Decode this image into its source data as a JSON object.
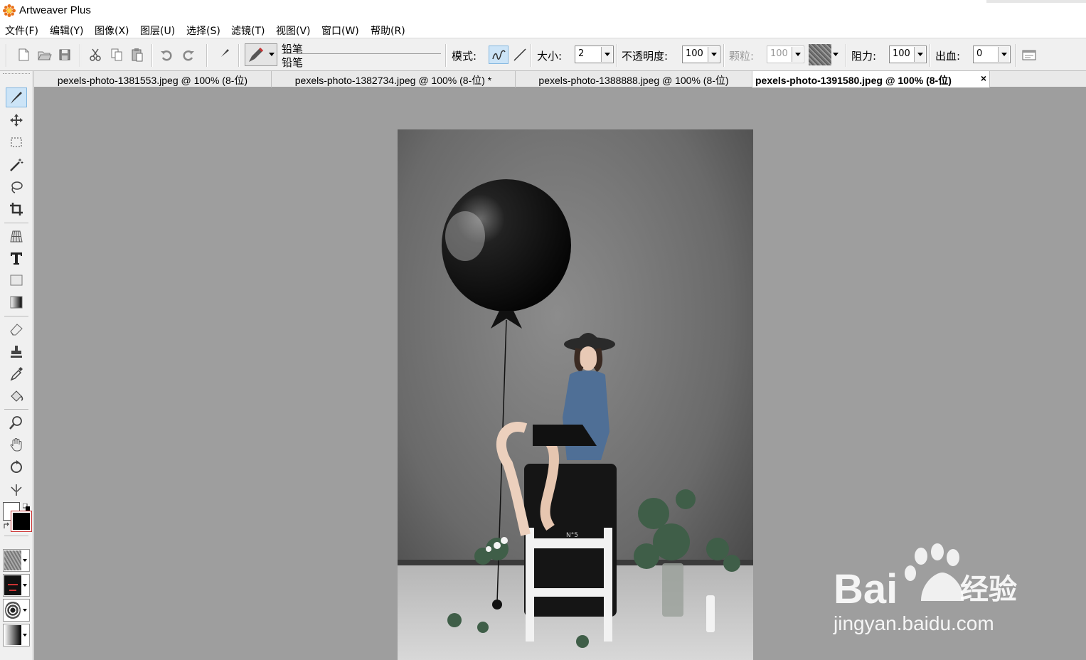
{
  "app": {
    "title": "Artweaver Plus"
  },
  "menu": [
    "文件(F)",
    "编辑(Y)",
    "图像(X)",
    "图层(U)",
    "选择(S)",
    "滤镜(T)",
    "视图(V)",
    "窗口(W)",
    "帮助(R)"
  ],
  "toolbar": {
    "brush_category": "铅笔",
    "brush_variant": "铅笔",
    "mode_label": "模式:",
    "size_label": "大小:",
    "size_value": "2",
    "opacity_label": "不透明度:",
    "opacity_value": "100",
    "grain_label": "颗粒:",
    "grain_value": "100",
    "resistance_label": "阻力:",
    "resistance_value": "100",
    "bleed_label": "出血:",
    "bleed_value": "0"
  },
  "tabs": [
    {
      "label": "pexels-photo-1381553.jpeg @ 100% (8-位)"
    },
    {
      "label": "pexels-photo-1382734.jpeg @ 100% (8-位) *"
    },
    {
      "label": "pexels-photo-1388888.jpeg @ 100% (8-位)"
    },
    {
      "label": "pexels-photo-1391580.jpeg @ 100% (8-位)",
      "active": true
    }
  ],
  "tab_close": "×",
  "photo": {
    "barrel_label": "N°5"
  },
  "watermark": {
    "brand": "Bai",
    "brand2": "经验",
    "url": "jingyan.baidu.com"
  },
  "colors": {
    "canvas_bg": "#9e9e9e",
    "ui_bg": "#f0f0f0",
    "foreground": "#000000",
    "background": "#ffffff"
  }
}
